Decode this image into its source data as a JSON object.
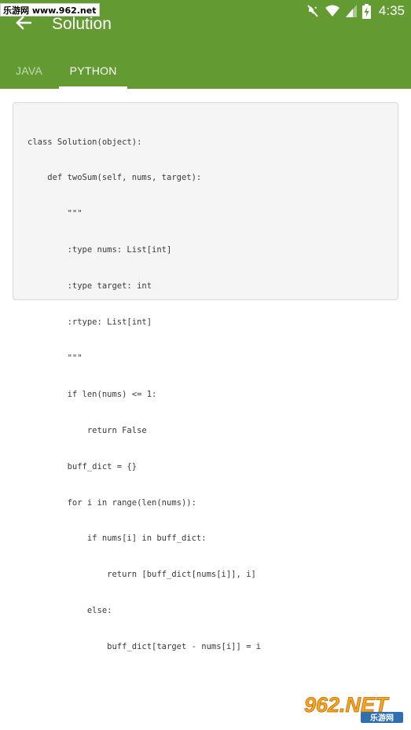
{
  "watermark": "乐游网 www.962.net",
  "status_bar": {
    "time": "4:35",
    "icons": [
      "mute-icon",
      "wifi-icon",
      "signal-icon",
      "battery-charging-icon"
    ]
  },
  "toolbar": {
    "back_icon": "arrow-left-icon",
    "title": "Solution"
  },
  "tabs": [
    {
      "label": "JAVA",
      "active": false
    },
    {
      "label": "PYTHON",
      "active": true
    }
  ],
  "code_lines": [
    "class Solution(object):",
    "    def twoSum(self, nums, target):",
    "        \"\"\"",
    "        :type nums: List[int]",
    "        :type target: int",
    "        :rtype: List[int]",
    "        \"\"\"",
    "        if len(nums) <= 1:",
    "            return False",
    "        buff_dict = {}",
    "        for i in range(len(nums)):",
    "            if nums[i] in buff_dict:",
    "                return [buff_dict[nums[i]], i]",
    "            else:",
    "                buff_dict[target - nums[i]] = i"
  ],
  "logo": {
    "text": "962.NET",
    "subtext": "乐游网"
  },
  "colors": {
    "app_bar": "#639b32",
    "code_background": "#f5f5f5",
    "tab_indicator": "#ffffff"
  }
}
